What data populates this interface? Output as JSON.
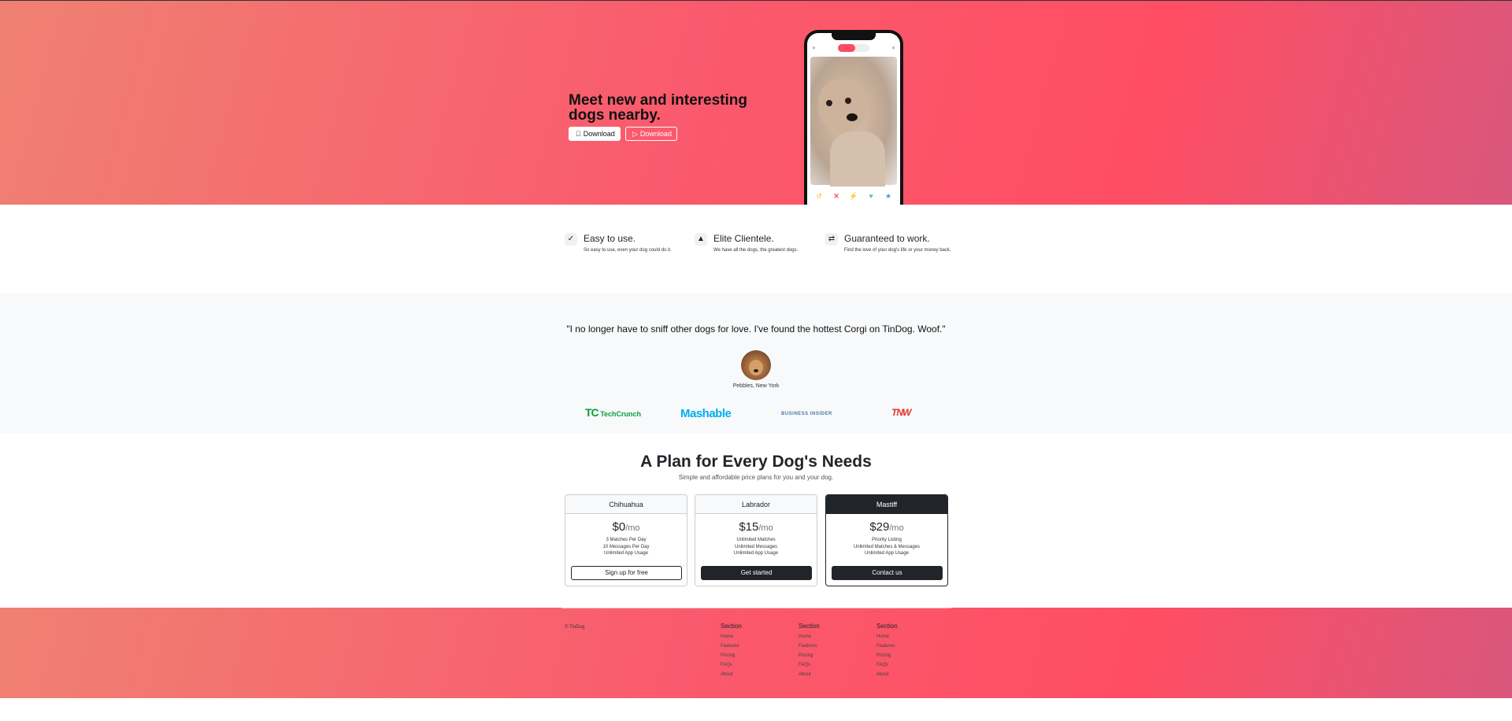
{
  "hero": {
    "title": "Meet new and interesting dogs nearby.",
    "download_apple_label": "Download",
    "download_play_label": "Download"
  },
  "features": [
    {
      "title": "Easy to use.",
      "text": "So easy to use, even your dog could do it.",
      "icon": "check-circle-icon"
    },
    {
      "title": "Elite Clientele.",
      "text": "We have all the dogs, the greatest dogs.",
      "icon": "graduation-cap-icon"
    },
    {
      "title": "Guaranteed to work.",
      "text": "Find the love of your dog's life or your money back.",
      "icon": "heart-arrows-icon"
    }
  ],
  "testimonial": {
    "quote": "\"I no longer have to sniff other dogs for love. I've found the hottest Corgi on TinDog. Woof.\"",
    "cite": "Pebbles, New York"
  },
  "press": {
    "techcrunch": "TechCrunch",
    "mashable": "Mashable",
    "business_insider": "BUSINESS INSIDER",
    "tnw": "TNW"
  },
  "pricing": {
    "title": "A Plan for Every Dog's Needs",
    "subtitle": "Simple and affordable price plans for you and your dog.",
    "plans": [
      {
        "name": "Chihuahua",
        "price": "$0",
        "per": "/mo",
        "features": [
          "3 Matches Per Day",
          "10 Messages Per Day",
          "Unlimited App Usage"
        ],
        "cta": "Sign up for free"
      },
      {
        "name": "Labrador",
        "price": "$15",
        "per": "/mo",
        "features": [
          "Unlimited Matches",
          "Unlimited Messages",
          "Unlimited App Usage"
        ],
        "cta": "Get started"
      },
      {
        "name": "Mastiff",
        "price": "$29",
        "per": "/mo",
        "features": [
          "Priority Listing",
          "Unlimited Matches & Messages",
          "Unlimited App Usage"
        ],
        "cta": "Contact us"
      }
    ]
  },
  "footer": {
    "copyright": "© TinDog",
    "columns": [
      {
        "title": "Section",
        "links": [
          "Home",
          "Features",
          "Pricing",
          "FAQs",
          "About"
        ]
      },
      {
        "title": "Section",
        "links": [
          "Home",
          "Features",
          "Pricing",
          "FAQs",
          "About"
        ]
      },
      {
        "title": "Section",
        "links": [
          "Home",
          "Features",
          "Pricing",
          "FAQs",
          "About"
        ]
      }
    ]
  },
  "colors": {
    "brand": "#ff4c68",
    "dark": "#212529",
    "light_bg": "#f8f9fa"
  }
}
